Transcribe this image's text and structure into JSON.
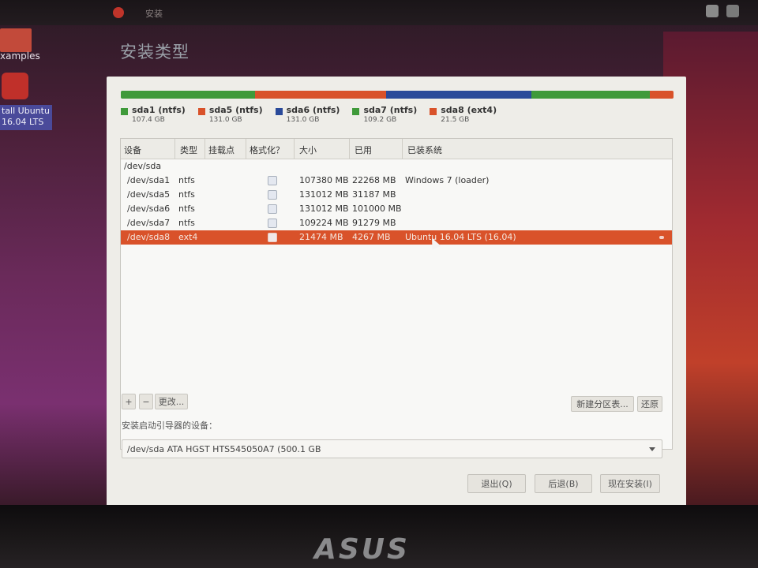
{
  "window": {
    "title": "安装",
    "heading": "安装类型"
  },
  "desktop": {
    "examples_label": "xamples",
    "install_label": "tall Ubuntu 16.04 LTS"
  },
  "partition_bar": [
    {
      "name": "sda1 (ntfs)",
      "size": "107.4 GB",
      "color": "#3f9a3a"
    },
    {
      "name": "sda5 (ntfs)",
      "size": "131.0 GB",
      "color": "#d9522a"
    },
    {
      "name": "sda6 (ntfs)",
      "size": "131.0 GB",
      "color": "#2a4a9a"
    },
    {
      "name": "sda7 (ntfs)",
      "size": "109.2 GB",
      "color": "#3f9a3a"
    },
    {
      "name": "sda8 (ext4)",
      "size": "21.5 GB",
      "color": "#d9522a"
    }
  ],
  "table": {
    "columns": [
      "设备",
      "类型",
      "挂载点",
      "格式化？",
      "大小",
      "已用",
      "已装系统"
    ],
    "drive": "/dev/sda",
    "rows": [
      {
        "device": "/dev/sda1",
        "type": "ntfs",
        "mount": "",
        "size": "107380 MB",
        "used": "22268 MB",
        "system": "Windows 7 (loader)",
        "selected": false
      },
      {
        "device": "/dev/sda5",
        "type": "ntfs",
        "mount": "",
        "size": "131012 MB",
        "used": "31187 MB",
        "system": "",
        "selected": false
      },
      {
        "device": "/dev/sda6",
        "type": "ntfs",
        "mount": "",
        "size": "131012 MB",
        "used": "101000 MB",
        "system": "",
        "selected": false
      },
      {
        "device": "/dev/sda7",
        "type": "ntfs",
        "mount": "",
        "size": "109224 MB",
        "used": "91279 MB",
        "system": "",
        "selected": false
      },
      {
        "device": "/dev/sda8",
        "type": "ext4",
        "mount": "",
        "size": "21474 MB",
        "used": "4267 MB",
        "system": "Ubuntu 16.04 LTS (16.04)",
        "selected": true
      }
    ]
  },
  "toolbar": {
    "add": "+",
    "remove": "−",
    "change": "更改...",
    "new_table": "新建分区表...",
    "revert": "还原"
  },
  "boot": {
    "label": "安装启动引导器的设备：",
    "value": "/dev/sda   ATA HGST HTS545050A7 (500.1 GB"
  },
  "footer": {
    "quit": "退出(Q)",
    "back": "后退(B)",
    "install": "现在安装(I)"
  },
  "bezel": {
    "brand": "ASUS"
  }
}
